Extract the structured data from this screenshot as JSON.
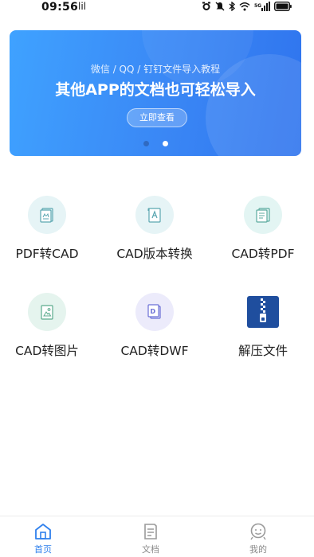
{
  "status": {
    "time": "09:56",
    "network": "Ⓜ",
    "signal": "5G",
    "icons": [
      "alarm-icon",
      "mute-icon",
      "bluetooth-icon",
      "wifi-icon",
      "signal-icon",
      "battery-icon"
    ]
  },
  "banner": {
    "subtitle": "微信 / QQ / 钉钉文件导入教程",
    "title": "其他APP的文档也可轻松导入",
    "button": "立即查看",
    "pages": 2,
    "active_page": 2,
    "gradient": [
      "#3fa2ff",
      "#2f74ee"
    ]
  },
  "tools": [
    {
      "label": "PDF转CAD",
      "icon": "pdf-to-cad-icon"
    },
    {
      "label": "CAD版本转换",
      "icon": "cad-version-icon"
    },
    {
      "label": "CAD转PDF",
      "icon": "cad-to-pdf-icon"
    },
    {
      "label": "CAD转图片",
      "icon": "cad-to-image-icon"
    },
    {
      "label": "CAD转DWF",
      "icon": "cad-to-dwf-icon"
    },
    {
      "label": "解压文件",
      "icon": "unzip-icon"
    }
  ],
  "tabbar": {
    "items": [
      {
        "label": "首页",
        "icon": "home-icon",
        "active": true
      },
      {
        "label": "文档",
        "icon": "document-icon",
        "active": false
      },
      {
        "label": "我的",
        "icon": "profile-icon",
        "active": false
      }
    ],
    "active_color": "#2f80ed",
    "inactive_color": "#8a8a8a"
  }
}
